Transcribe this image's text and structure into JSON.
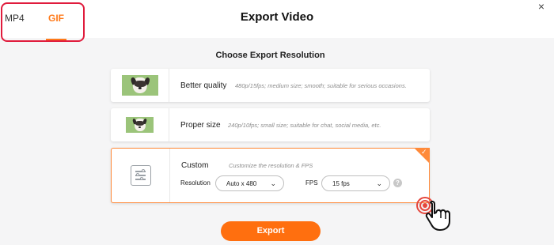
{
  "header": {
    "title": "Export Video",
    "tabs": [
      {
        "label": "MP4",
        "active": false
      },
      {
        "label": "GIF",
        "active": true
      }
    ],
    "close_icon": "close-icon",
    "close_glyph": "×"
  },
  "section_title": "Choose Export Resolution",
  "options": [
    {
      "name": "Better quality",
      "description": "480p/15fps; medium size; smooth; suitable for serious occasions.",
      "thumbnail": "dog-photo"
    },
    {
      "name": "Proper size",
      "description": "240p/10fps; small size; suitable for chat, social media, etc.",
      "thumbnail": "dog-photo"
    },
    {
      "name": "Custom",
      "description": "Customize the resolution & FPS",
      "thumbnail": "sliders-icon",
      "selected": true,
      "resolution": {
        "label": "Resolution",
        "value": "Auto x 480"
      },
      "fps": {
        "label": "FPS",
        "value": "15 fps"
      },
      "help_glyph": "?",
      "check_glyph": "✓"
    }
  ],
  "export_button": "Export",
  "colors": {
    "accent": "#ff6f0f",
    "highlight_border": "#e01b3c"
  }
}
